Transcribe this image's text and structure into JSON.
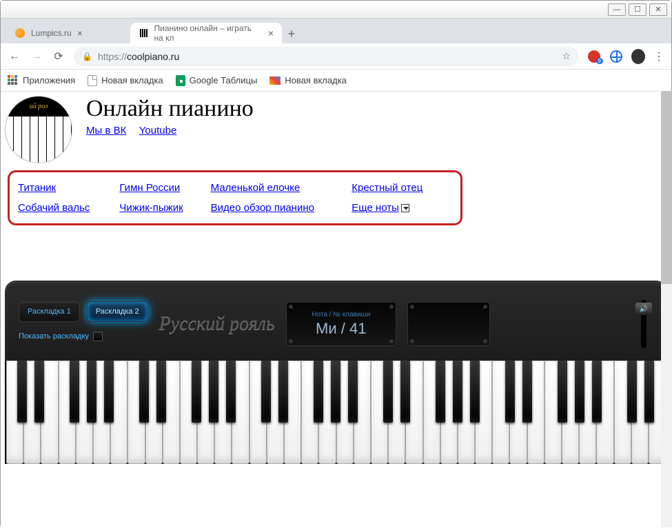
{
  "window": {
    "minimize": "—",
    "maximize": "☐",
    "close": "✕"
  },
  "tabs": [
    {
      "title": "Lumpics.ru",
      "active": false
    },
    {
      "title": "Пианино онлайн – играть на кл",
      "active": true
    }
  ],
  "nav": {
    "back": "←",
    "forward": "→",
    "reload": "⟳",
    "url_prefix": "https://",
    "url_host": "coolpiano.ru",
    "menu": "⋮"
  },
  "bookmarks": {
    "apps": "Приложения",
    "items": [
      "Новая вкладка",
      "Google Таблицы",
      "Новая вкладка"
    ]
  },
  "page": {
    "title": "Онлайн пианино",
    "header_links": [
      {
        "label": "Мы в ВК"
      },
      {
        "label": "Youtube"
      }
    ],
    "songs": [
      [
        {
          "label": "Титаник"
        },
        {
          "label": "Гимн России"
        },
        {
          "label": "Маленькой елочке"
        },
        {
          "label": "Крестный отец"
        }
      ],
      [
        {
          "label": "Собачий вальс"
        },
        {
          "label": "Чижик-пыжик"
        },
        {
          "label": "Видео обзор пианино"
        },
        {
          "label": "Еще ноты"
        }
      ]
    ],
    "piano": {
      "layout1": "Раскладка 1",
      "layout2": "Раскладка 2",
      "show_layout": "Показать раскладку",
      "brand": "Русский рояль",
      "display_label": "Нота / № клавиши",
      "display_value": "Ми / 41",
      "volume_icon": "🔊"
    }
  }
}
